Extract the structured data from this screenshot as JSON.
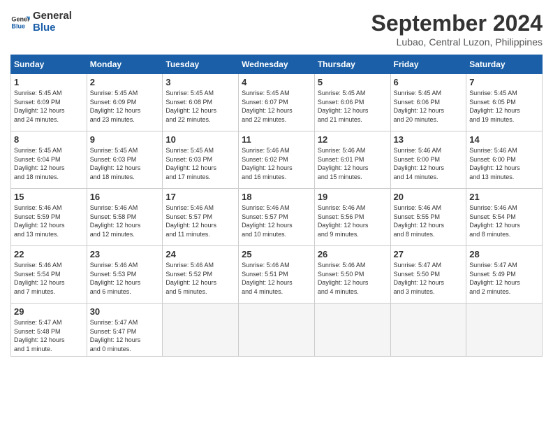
{
  "header": {
    "logo_line1": "General",
    "logo_line2": "Blue",
    "title": "September 2024",
    "location": "Lubao, Central Luzon, Philippines"
  },
  "weekdays": [
    "Sunday",
    "Monday",
    "Tuesday",
    "Wednesday",
    "Thursday",
    "Friday",
    "Saturday"
  ],
  "weeks": [
    [
      {
        "day": "1",
        "info": "Sunrise: 5:45 AM\nSunset: 6:09 PM\nDaylight: 12 hours\nand 24 minutes."
      },
      {
        "day": "2",
        "info": "Sunrise: 5:45 AM\nSunset: 6:09 PM\nDaylight: 12 hours\nand 23 minutes."
      },
      {
        "day": "3",
        "info": "Sunrise: 5:45 AM\nSunset: 6:08 PM\nDaylight: 12 hours\nand 22 minutes."
      },
      {
        "day": "4",
        "info": "Sunrise: 5:45 AM\nSunset: 6:07 PM\nDaylight: 12 hours\nand 22 minutes."
      },
      {
        "day": "5",
        "info": "Sunrise: 5:45 AM\nSunset: 6:06 PM\nDaylight: 12 hours\nand 21 minutes."
      },
      {
        "day": "6",
        "info": "Sunrise: 5:45 AM\nSunset: 6:06 PM\nDaylight: 12 hours\nand 20 minutes."
      },
      {
        "day": "7",
        "info": "Sunrise: 5:45 AM\nSunset: 6:05 PM\nDaylight: 12 hours\nand 19 minutes."
      }
    ],
    [
      {
        "day": "8",
        "info": "Sunrise: 5:45 AM\nSunset: 6:04 PM\nDaylight: 12 hours\nand 18 minutes."
      },
      {
        "day": "9",
        "info": "Sunrise: 5:45 AM\nSunset: 6:03 PM\nDaylight: 12 hours\nand 18 minutes."
      },
      {
        "day": "10",
        "info": "Sunrise: 5:45 AM\nSunset: 6:03 PM\nDaylight: 12 hours\nand 17 minutes."
      },
      {
        "day": "11",
        "info": "Sunrise: 5:46 AM\nSunset: 6:02 PM\nDaylight: 12 hours\nand 16 minutes."
      },
      {
        "day": "12",
        "info": "Sunrise: 5:46 AM\nSunset: 6:01 PM\nDaylight: 12 hours\nand 15 minutes."
      },
      {
        "day": "13",
        "info": "Sunrise: 5:46 AM\nSunset: 6:00 PM\nDaylight: 12 hours\nand 14 minutes."
      },
      {
        "day": "14",
        "info": "Sunrise: 5:46 AM\nSunset: 6:00 PM\nDaylight: 12 hours\nand 13 minutes."
      }
    ],
    [
      {
        "day": "15",
        "info": "Sunrise: 5:46 AM\nSunset: 5:59 PM\nDaylight: 12 hours\nand 13 minutes."
      },
      {
        "day": "16",
        "info": "Sunrise: 5:46 AM\nSunset: 5:58 PM\nDaylight: 12 hours\nand 12 minutes."
      },
      {
        "day": "17",
        "info": "Sunrise: 5:46 AM\nSunset: 5:57 PM\nDaylight: 12 hours\nand 11 minutes."
      },
      {
        "day": "18",
        "info": "Sunrise: 5:46 AM\nSunset: 5:57 PM\nDaylight: 12 hours\nand 10 minutes."
      },
      {
        "day": "19",
        "info": "Sunrise: 5:46 AM\nSunset: 5:56 PM\nDaylight: 12 hours\nand 9 minutes."
      },
      {
        "day": "20",
        "info": "Sunrise: 5:46 AM\nSunset: 5:55 PM\nDaylight: 12 hours\nand 8 minutes."
      },
      {
        "day": "21",
        "info": "Sunrise: 5:46 AM\nSunset: 5:54 PM\nDaylight: 12 hours\nand 8 minutes."
      }
    ],
    [
      {
        "day": "22",
        "info": "Sunrise: 5:46 AM\nSunset: 5:54 PM\nDaylight: 12 hours\nand 7 minutes."
      },
      {
        "day": "23",
        "info": "Sunrise: 5:46 AM\nSunset: 5:53 PM\nDaylight: 12 hours\nand 6 minutes."
      },
      {
        "day": "24",
        "info": "Sunrise: 5:46 AM\nSunset: 5:52 PM\nDaylight: 12 hours\nand 5 minutes."
      },
      {
        "day": "25",
        "info": "Sunrise: 5:46 AM\nSunset: 5:51 PM\nDaylight: 12 hours\nand 4 minutes."
      },
      {
        "day": "26",
        "info": "Sunrise: 5:46 AM\nSunset: 5:50 PM\nDaylight: 12 hours\nand 4 minutes."
      },
      {
        "day": "27",
        "info": "Sunrise: 5:47 AM\nSunset: 5:50 PM\nDaylight: 12 hours\nand 3 minutes."
      },
      {
        "day": "28",
        "info": "Sunrise: 5:47 AM\nSunset: 5:49 PM\nDaylight: 12 hours\nand 2 minutes."
      }
    ],
    [
      {
        "day": "29",
        "info": "Sunrise: 5:47 AM\nSunset: 5:48 PM\nDaylight: 12 hours\nand 1 minute."
      },
      {
        "day": "30",
        "info": "Sunrise: 5:47 AM\nSunset: 5:47 PM\nDaylight: 12 hours\nand 0 minutes."
      },
      {
        "day": "",
        "info": ""
      },
      {
        "day": "",
        "info": ""
      },
      {
        "day": "",
        "info": ""
      },
      {
        "day": "",
        "info": ""
      },
      {
        "day": "",
        "info": ""
      }
    ]
  ]
}
